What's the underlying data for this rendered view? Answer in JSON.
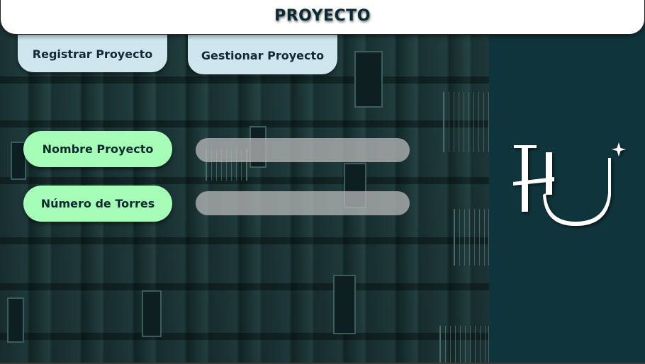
{
  "header": {
    "title": "PROYECTO"
  },
  "tabs": {
    "register_label": "Registrar Proyecto",
    "manage_label": "Gestionar Proyecto"
  },
  "form": {
    "project_name": {
      "label": "Nombre Proyecto",
      "value": ""
    },
    "towers": {
      "label": "Número de Torres",
      "value": ""
    }
  },
  "logo": {
    "text": "HU"
  },
  "colors": {
    "header_bg": "#ffffff",
    "title": "#0b2a33",
    "tab_bg": "#cfe6ef",
    "label_bg": "#a6fdb8",
    "field_bg": "#b9b9b9",
    "panel_bg": "#0f343b"
  }
}
